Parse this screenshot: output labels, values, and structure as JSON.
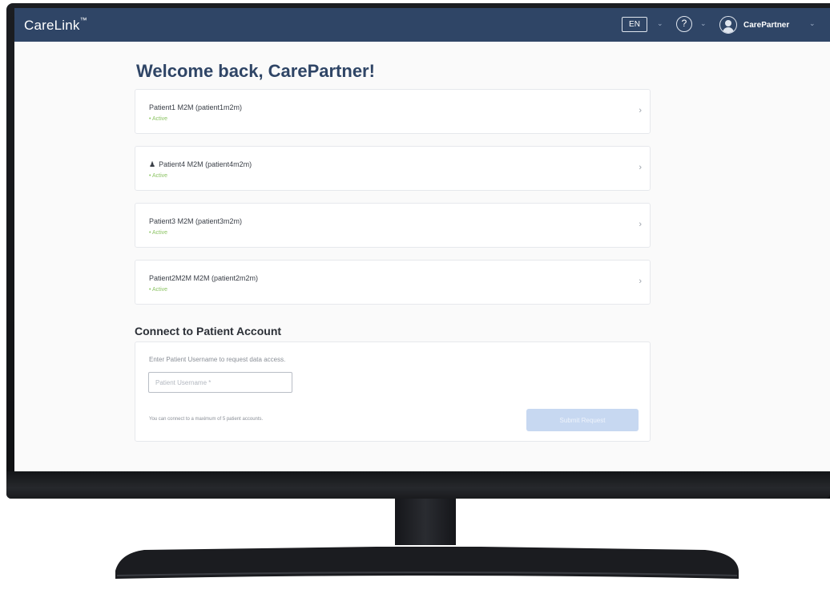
{
  "header": {
    "logo": "CareLink",
    "trademark": "™",
    "language": "EN",
    "help_symbol": "?",
    "user_name": "CarePartner",
    "caret": "⌄"
  },
  "main": {
    "welcome": "Welcome back, CarePartner!",
    "patients": [
      {
        "name": "Patient1 M2M (patient1m2m)",
        "status": "• Active",
        "icon": null
      },
      {
        "name": "Patient4 M2M (patient4m2m)",
        "status": "• Active",
        "icon": "person-icon"
      },
      {
        "name": "Patient3 M2M (patient3m2m)",
        "status": "• Active",
        "icon": null
      },
      {
        "name": "Patient2M2M M2M (patient2m2m)",
        "status": "• Active",
        "icon": null
      }
    ],
    "chevron": "›"
  },
  "connect": {
    "title": "Connect to Patient Account",
    "instruction": "Enter Patient Username to request data access.",
    "placeholder": "Patient Username *",
    "limit_note": "You can connect to a maximum of 5 patient accounts.",
    "submit_label": "Submit Request"
  },
  "colors": {
    "header_bg": "#2f4566",
    "title": "#2f4566",
    "active_status": "#8cc464",
    "submit_disabled": "#c7d8f1"
  }
}
